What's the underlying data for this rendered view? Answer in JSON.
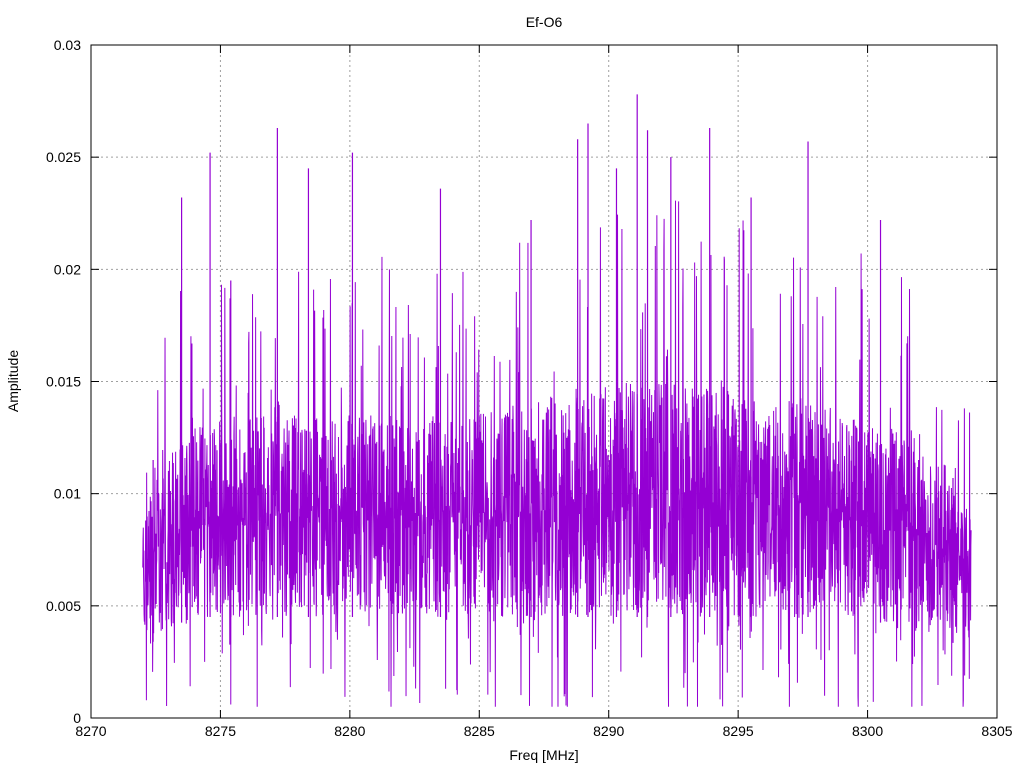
{
  "chart_data": {
    "type": "line",
    "title": "Ef-O6",
    "xlabel": "Freq [MHz]",
    "ylabel": "Amplitude",
    "xlim": [
      8270,
      8305
    ],
    "ylim": [
      0,
      0.03
    ],
    "xticks": [
      8270,
      8275,
      8280,
      8285,
      8290,
      8295,
      8300,
      8305
    ],
    "xtick_labels": [
      "8270",
      "8275",
      "8280",
      "8285",
      "8290",
      "8295",
      "8300",
      "8305"
    ],
    "yticks": [
      0,
      0.005,
      0.01,
      0.015,
      0.02,
      0.025,
      0.03
    ],
    "ytick_labels": [
      "0",
      "0.005",
      "0.01",
      "0.015",
      "0.02",
      "0.025",
      "0.03"
    ],
    "grid": true,
    "legend": "none",
    "series": [
      {
        "color": "#9400d3",
        "x_range": [
          8272,
          8304
        ],
        "envelope": {
          "x": [
            8272,
            8273,
            8274,
            8275,
            8276,
            8277,
            8278,
            8279,
            8280,
            8281,
            8282,
            8283,
            8284,
            8285,
            8286,
            8287,
            8288,
            8289,
            8290,
            8291,
            8292,
            8293,
            8294,
            8295,
            8296,
            8297,
            8298,
            8299,
            8300,
            8301,
            8302,
            8303,
            8304
          ],
          "typical_low": [
            0.003,
            0.004,
            0.0045,
            0.0045,
            0.0045,
            0.0045,
            0.0045,
            0.0045,
            0.0045,
            0.0045,
            0.0045,
            0.0045,
            0.0045,
            0.0045,
            0.0045,
            0.0045,
            0.0045,
            0.0045,
            0.0045,
            0.0045,
            0.0045,
            0.0045,
            0.0045,
            0.0045,
            0.0045,
            0.0045,
            0.0045,
            0.0045,
            0.0045,
            0.004,
            0.004,
            0.0035,
            0.003
          ],
          "typical_high": [
            0.009,
            0.012,
            0.013,
            0.0135,
            0.0135,
            0.0135,
            0.0135,
            0.0135,
            0.0135,
            0.0135,
            0.0135,
            0.0135,
            0.0135,
            0.0135,
            0.014,
            0.014,
            0.0145,
            0.0145,
            0.015,
            0.015,
            0.015,
            0.015,
            0.015,
            0.0145,
            0.0145,
            0.0145,
            0.014,
            0.014,
            0.0135,
            0.013,
            0.012,
            0.011,
            0.009
          ]
        },
        "peaks": [
          {
            "x": 8272.4,
            "y": 0.0115
          },
          {
            "x": 8273.5,
            "y": 0.0232
          },
          {
            "x": 8274.6,
            "y": 0.0252
          },
          {
            "x": 8275.4,
            "y": 0.0195
          },
          {
            "x": 8277.2,
            "y": 0.0263
          },
          {
            "x": 8278.4,
            "y": 0.0245
          },
          {
            "x": 8280.1,
            "y": 0.0252
          },
          {
            "x": 8283.5,
            "y": 0.0236
          },
          {
            "x": 8287.0,
            "y": 0.0222
          },
          {
            "x": 8288.8,
            "y": 0.0258
          },
          {
            "x": 8289.2,
            "y": 0.0265
          },
          {
            "x": 8290.3,
            "y": 0.0245
          },
          {
            "x": 8291.1,
            "y": 0.0278
          },
          {
            "x": 8291.5,
            "y": 0.0262
          },
          {
            "x": 8292.4,
            "y": 0.025
          },
          {
            "x": 8293.9,
            "y": 0.0263
          },
          {
            "x": 8295.5,
            "y": 0.0232
          },
          {
            "x": 8297.7,
            "y": 0.0257
          },
          {
            "x": 8300.5,
            "y": 0.0222
          },
          {
            "x": 8303.3,
            "y": 0.0107
          }
        ]
      }
    ]
  }
}
